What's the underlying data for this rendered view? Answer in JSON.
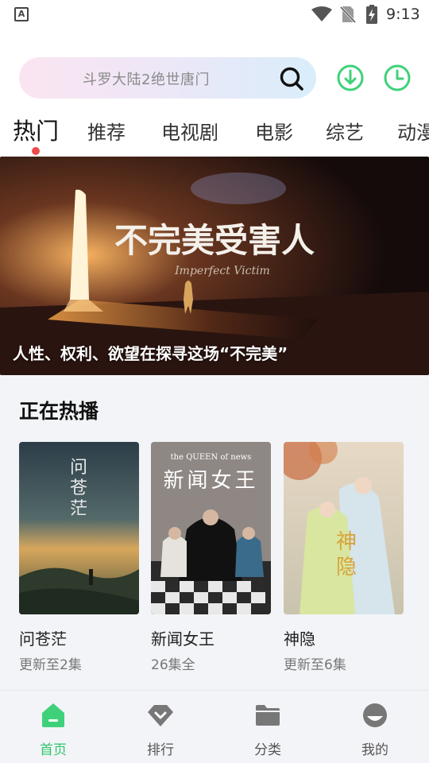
{
  "status_bar": {
    "app_icon_letter": "A",
    "time": "9:13",
    "icons": [
      "app-notification-icon",
      "wifi-icon",
      "no-sim-icon",
      "battery-charging-icon"
    ]
  },
  "search": {
    "placeholder": "斗罗大陆2绝世唐门",
    "icons": [
      "search-icon",
      "download-icon",
      "history-icon"
    ],
    "accent_color": "#3fd17a"
  },
  "tabs": [
    {
      "label": "热门",
      "active": true
    },
    {
      "label": "推荐",
      "active": false
    },
    {
      "label": "电视剧",
      "active": false
    },
    {
      "label": "电影",
      "active": false
    },
    {
      "label": "综艺",
      "active": false
    },
    {
      "label": "动漫",
      "active": false
    }
  ],
  "banner": {
    "caption": "人性、权利、欲望在探寻这场“不完美”",
    "artwork_title": "不完美受害人",
    "artwork_subtitle": "Imperfect Victim"
  },
  "now_playing": {
    "title": "正在热播",
    "items": [
      {
        "title": "问苍茫",
        "subtitle": "更新至2集",
        "poster_text": "问苍茫"
      },
      {
        "title": "新闻女王",
        "subtitle": "26集全",
        "poster_text": "新闻女王",
        "poster_caption": "the QUEEN of news"
      },
      {
        "title": "神隐",
        "subtitle": "更新至6集",
        "poster_text": "神隐"
      }
    ]
  },
  "bottom_nav": [
    {
      "label": "首页",
      "icon": "home-icon",
      "active": true
    },
    {
      "label": "排行",
      "icon": "ranking-icon",
      "active": false
    },
    {
      "label": "分类",
      "icon": "category-folder-icon",
      "active": false
    },
    {
      "label": "我的",
      "icon": "profile-icon",
      "active": false
    }
  ],
  "colors": {
    "active_green": "#2fc56c",
    "tab_dot_red": "#f04a4a"
  }
}
